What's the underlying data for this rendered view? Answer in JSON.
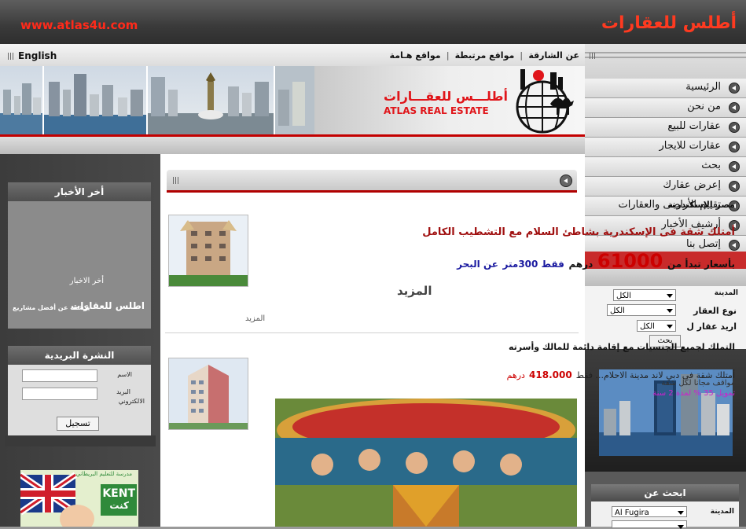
{
  "header": {
    "url_text": "www.atlas4u.com",
    "site_title": "أطلس للعقارات"
  },
  "topnav": {
    "language": "English",
    "links": [
      "عن الشارقة",
      "مواقع مرتبطة",
      "مواقع هـامة"
    ]
  },
  "logo": {
    "arabic": "أطلـــس للعقـــارات",
    "english": "ATLAS REAL ESTATE"
  },
  "menu": {
    "items": [
      "الرئيسية",
      "من نحن",
      "عقارات للبيع",
      "عقارات للايجار",
      "بحث",
      "إعرض عقارك",
      "تقييم الأراضى والعقارات",
      "أرشيف الأخبار",
      "إتصل بنا"
    ]
  },
  "quick_search": {
    "city_label": "المدينة",
    "type_label": "نوع العقار",
    "want_label": "اريد عقار ل",
    "city_value": "الكل",
    "type_value": "الكل",
    "want_value": "الكل",
    "button": "بحث"
  },
  "search_box": {
    "title": "ابحث عن",
    "city_label": "المدينة",
    "city_value": "Al Fugira"
  },
  "news": {
    "title": "أخر الأخبار",
    "item_title": "أخر الاخبار",
    "item_company": "اطلس للعقارات",
    "item_desc": "يكشف عن أفضل مشاريع"
  },
  "newsletter": {
    "title": "النشرة البريدية",
    "name_label": "الاسم",
    "email_label_1": "البريد",
    "email_label_2": "الالكتروني",
    "button": "تسجيل"
  },
  "ad": {
    "brand": "KENT",
    "brand_ar": "كنت",
    "tagline": "مدرسة للتعليم البريطاني"
  },
  "listing1": {
    "location": "مصر الإسكندرية",
    "headline": "أمتلك شقة فى الإسكندرية بشاطئ السلام مع التشطيب الكامل",
    "price_prefix": "بأسعار تبدأ من",
    "price": "61000",
    "currency": "درهم",
    "extra": "فقط 300متر",
    "extra2": "عن البحر",
    "more_big": "المزيد",
    "more_small": "المزيد"
  },
  "listing2": {
    "headline": "التملك لجميع الجنسيات مع إقامة دائمة للمالك وأسرته",
    "line1_a": "أمتلك شقة فى دبي لاند مدينة الاحلام... فقط",
    "line1_b": "418.000",
    "line1_c": "درهم",
    "line2": "مواقف مجانا لكل شقة",
    "line3": "تمويل 35 % لمدة 2 سنة"
  },
  "colors": {
    "accent_red": "#c82b2b",
    "title_red": "#ff3a20",
    "price_red": "#cc0000",
    "link_blue": "#1a1aa0",
    "promo_magenta": "#cc22cc"
  }
}
